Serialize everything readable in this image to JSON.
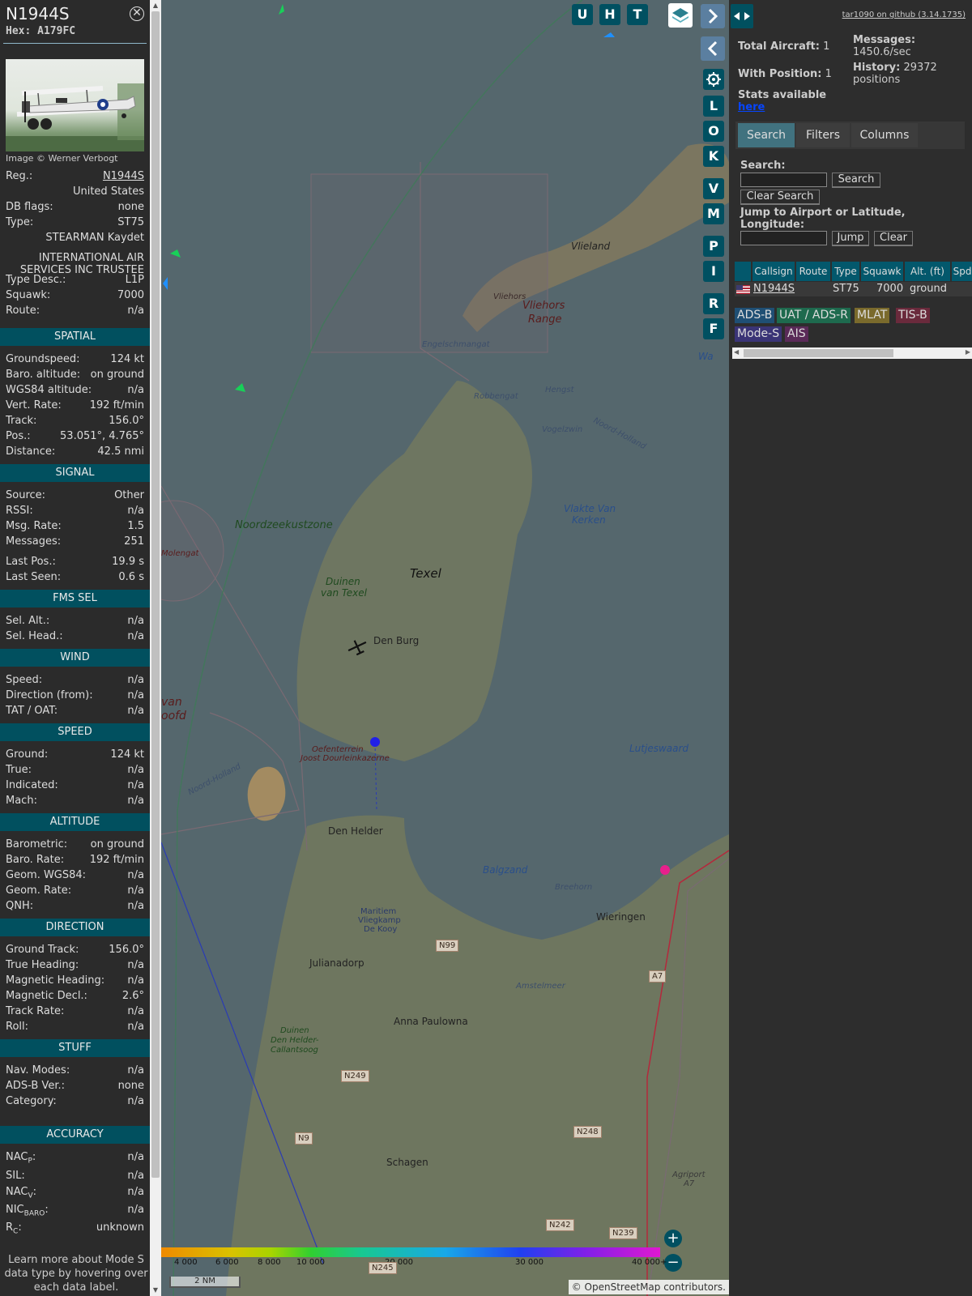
{
  "info": {
    "callsign": "N1944S",
    "hex": "Hex: A179FC",
    "image_credit": "Image © Werner Verbogt",
    "reg_label": "Reg.:",
    "reg_value": "N1944S",
    "country": "United States",
    "dbflags_label": "DB flags:",
    "dbflags_value": "none",
    "type_label": "Type:",
    "type_value": "ST75",
    "type_name": "STEARMAN Kaydet",
    "owner": "INTERNATIONAL AIR SERVICES INC TRUSTEE",
    "typedesc_label": "Type Desc.:",
    "typedesc_value": "L1P",
    "squawk_label": "Squawk:",
    "squawk_value": "7000",
    "route_label": "Route:",
    "route_value": "n/a",
    "spatial": {
      "header": "SPATIAL",
      "groundspeed_label": "Groundspeed:",
      "groundspeed_value": "124 kt",
      "baroalt_label": "Baro. altitude:",
      "baroalt_value": "on ground",
      "wgs_label": "WGS84 altitude:",
      "wgs_value": "n/a",
      "vert_label": "Vert. Rate:",
      "vert_value": "192 ft/min",
      "track_label": "Track:",
      "track_value": "156.0°",
      "pos_label": "Pos.:",
      "pos_value": "53.051°, 4.765°",
      "dist_label": "Distance:",
      "dist_value": "42.5 nmi"
    },
    "signal": {
      "header": "SIGNAL",
      "source_label": "Source:",
      "source_value": "Other",
      "rssi_label": "RSSI:",
      "rssi_value": "n/a",
      "msgrate_label": "Msg. Rate:",
      "msgrate_value": "1.5",
      "messages_label": "Messages:",
      "messages_value": "251",
      "lastpos_label": "Last Pos.:",
      "lastpos_value": "19.9 s",
      "lastseen_label": "Last Seen:",
      "lastseen_value": "0.6 s"
    },
    "fms": {
      "header": "FMS SEL",
      "selalt_label": "Sel. Alt.:",
      "selalt_value": "n/a",
      "selhead_label": "Sel. Head.:",
      "selhead_value": "n/a"
    },
    "wind": {
      "header": "WIND",
      "speed_label": "Speed:",
      "speed_value": "n/a",
      "dir_label": "Direction (from):",
      "dir_value": "n/a",
      "tat_label": "TAT / OAT:",
      "tat_value": "n/a"
    },
    "speed": {
      "header": "SPEED",
      "ground_label": "Ground:",
      "ground_value": "124 kt",
      "true_label": "True:",
      "true_value": "n/a",
      "ind_label": "Indicated:",
      "ind_value": "n/a",
      "mach_label": "Mach:",
      "mach_value": "n/a"
    },
    "altitude": {
      "header": "ALTITUDE",
      "baro_label": "Barometric:",
      "baro_value": "on ground",
      "bararate_label": "Baro. Rate:",
      "bararate_value": "192 ft/min",
      "geom_label": "Geom. WGS84:",
      "geom_value": "n/a",
      "geomrate_label": "Geom. Rate:",
      "geomrate_value": "n/a",
      "qnh_label": "QNH:",
      "qnh_value": "n/a"
    },
    "direction": {
      "header": "DIRECTION",
      "gt_label": "Ground Track:",
      "gt_value": "156.0°",
      "th_label": "True Heading:",
      "th_value": "n/a",
      "mh_label": "Magnetic Heading:",
      "mh_value": "n/a",
      "md_label": "Magnetic Decl.:",
      "md_value": "2.6°",
      "tr_label": "Track Rate:",
      "tr_value": "n/a",
      "roll_label": "Roll:",
      "roll_value": "n/a"
    },
    "stuff": {
      "header": "STUFF",
      "nav_label": "Nav. Modes:",
      "nav_value": "n/a",
      "adsb_label": "ADS-B Ver.:",
      "adsb_value": "none",
      "cat_label": "Category:",
      "cat_value": "n/a"
    },
    "accuracy": {
      "header": "ACCURACY",
      "nacp_main": "NAC",
      "nacp_sub": "P",
      "nacp_value": "n/a",
      "sil_label": "SIL:",
      "sil_value": "n/a",
      "nacv_main": "NAC",
      "nacv_sub": "V",
      "nacv_value": "n/a",
      "nic_main": "NIC",
      "nic_sub": "BARO",
      "nic_value": "n/a",
      "rc_main": "R",
      "rc_sub": "C",
      "rc_value": "unknown"
    },
    "learn_more": "Learn more about Mode S data type by hovering over each data label."
  },
  "map": {
    "buttons": [
      "U",
      "H",
      "T"
    ],
    "side_buttons": [
      "L",
      "O",
      "K",
      "V",
      "M",
      "P",
      "I",
      "R",
      "F"
    ],
    "places": {
      "vlieland": "Vlieland",
      "vliehors": "Vliehors",
      "vliehors_range_1": "Vliehors",
      "vliehors_range_2": "Range",
      "engelschmangat": "Engelschmangat",
      "robbengat": "Robbengat",
      "hengst": "Hengst",
      "vogelzwin": "Vogelzwin",
      "noord_holland": "Noord-Holland",
      "vlakte_1": "Vlakte Van",
      "vlakte_2": "Kerken",
      "noordzeekustzone": "Noordzeekustzone",
      "molengat": "Molengat",
      "texel": "Texel",
      "duinen_texel_1": "Duinen",
      "duinen_texel_2": "van Texel",
      "den_burg": "Den Burg",
      "oefen_1": "Oefenterrein",
      "oefen_2": "Joost Dourleinkazerne",
      "lutjeswaard": "Lutjeswaard",
      "noord_holland_2": "Noord-Holland",
      "den_helder": "Den Helder",
      "balgzand": "Balgzand",
      "breehorn": "Breehorn",
      "wieringen": "Wieringen",
      "maritiem_1": "Maritiem",
      "maritiem_2": "Vliegkamp",
      "maritiem_3": "De Kooy",
      "julianadorp": "Julianadorp",
      "amstelmeer": "Amstelmeer",
      "anna_paulowna": "Anna Paulowna",
      "duinen_dh_1": "Duinen",
      "duinen_dh_2": "Den Helder-",
      "duinen_dh_3": "Callantsoog",
      "schagen": "Schagen",
      "agriport_1": "Agriport",
      "agriport_2": "A7",
      "left_edge_1": "van",
      "left_edge_2": "oofd",
      "wa": "Wa"
    },
    "roads": {
      "n99": "N99",
      "a7": "A7",
      "n249": "N249",
      "n9": "N9",
      "n248": "N248",
      "n242": "N242",
      "n239": "N239",
      "n245": "N245"
    },
    "legend_ticks": [
      "4 000",
      "6 000",
      "8 000",
      "10 000",
      "20 000",
      "30 000",
      "40 000+"
    ],
    "scale": "2 NM",
    "attribution": "© OpenStreetMap contributors."
  },
  "sidebar": {
    "github_link": "tar1090 on github (3.14.1735)",
    "total_label": "Total Aircraft:",
    "total_value": "1",
    "withpos_label": "With Position:",
    "withpos_value": "1",
    "messages_label": "Messages:",
    "messages_value": "1450.6/sec",
    "history_label": "History:",
    "history_value_1": "29372",
    "history_value_2": "positions",
    "stats_label": "Stats available",
    "stats_link": "here",
    "tabs": [
      "Search",
      "Filters",
      "Columns"
    ],
    "search_label": "Search:",
    "search_button": "Search",
    "clear_search": "Clear Search",
    "jump_label": "Jump to Airport or Latitude, Longitude:",
    "jump_button": "Jump",
    "clear_button": "Clear",
    "columns": [
      "Callsign",
      "Route",
      "Type",
      "Squawk",
      "Alt. (ft)",
      "Spd."
    ],
    "row": {
      "callsign": "N1944S",
      "type": "ST75",
      "squawk": "7000",
      "alt": "ground"
    },
    "sources": [
      {
        "label": "ADS-B",
        "bg": "#1f4f74"
      },
      {
        "label": "UAT / ADS-R",
        "bg": "#1e6a4e"
      },
      {
        "label": "MLAT",
        "bg": "#7a6a2c"
      },
      {
        "label": "TIS-B",
        "bg": "#6a2a3c"
      },
      {
        "label": "Mode-S",
        "bg": "#3a3476"
      },
      {
        "label": "AIS",
        "bg": "#5a2a58"
      }
    ]
  }
}
